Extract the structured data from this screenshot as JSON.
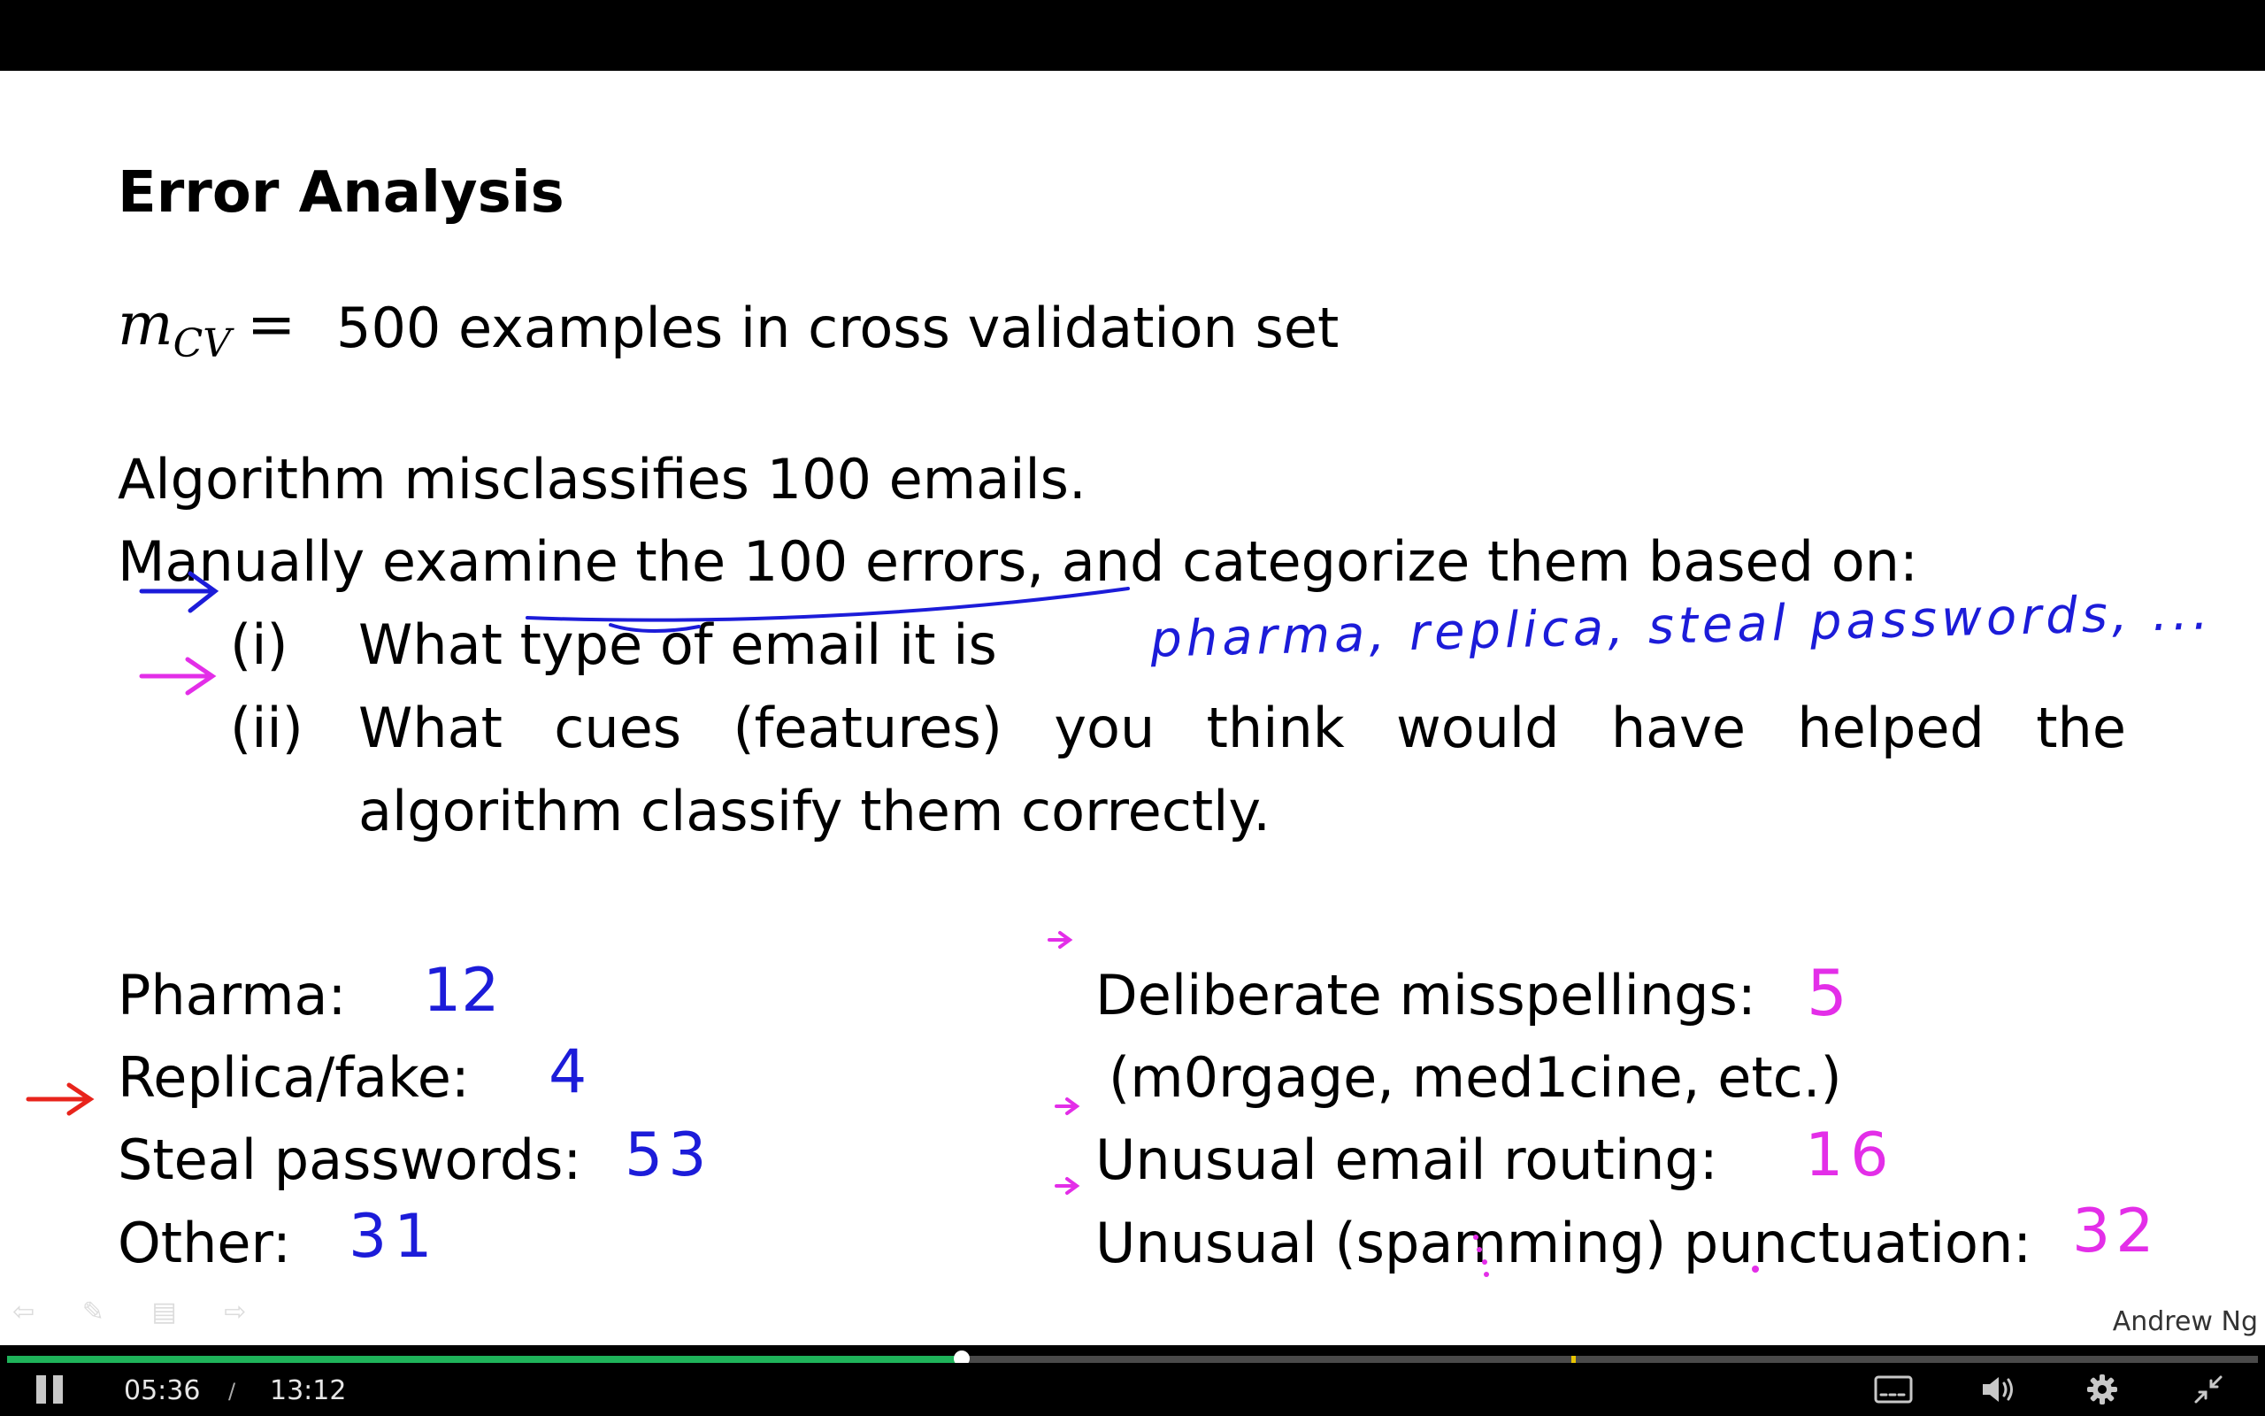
{
  "slide": {
    "title": "Error Analysis",
    "math_var": "m",
    "math_sub": "CV",
    "math_eq": "=",
    "line1": "500 examples in cross validation set",
    "line2": "Algorithm misclassifies 100 emails.",
    "line3": "Manually examine the 100 errors, and categorize them based on:",
    "item1_marker": "(i)",
    "item1_text": "What type of email it is",
    "item2_marker": "(ii)",
    "item2_line1": "What cues (features) you think would have helped the",
    "item2_line2": "algorithm classify them correctly.",
    "handwritten_types": "pharma, replica, steal passwords, ...",
    "categories": [
      {
        "label": "Pharma:",
        "count": "12"
      },
      {
        "label": "Replica/fake:",
        "count": "4"
      },
      {
        "label": "Steal passwords:",
        "count": "53"
      },
      {
        "label": "Other:",
        "count": "31"
      }
    ],
    "features": [
      {
        "label": "Deliberate misspellings:",
        "count": "5"
      },
      {
        "label": "(m0rgage, med1cine, etc.)",
        "count": ""
      },
      {
        "label": "Unusual email routing:",
        "count": "16"
      },
      {
        "label": "Unusual (spamming) punctuation:",
        "count": "32"
      }
    ],
    "author": "Andrew Ng",
    "ink_colors": {
      "blue": "#1c1cd9",
      "magenta": "#e32ee8",
      "red": "#e8241c"
    }
  },
  "player": {
    "current_time": "05:36",
    "separator": "/",
    "duration": "13:12",
    "progress_fraction": 0.4242,
    "marker_fraction": 0.695,
    "played_color": "#1fb35a",
    "buttons": {
      "pause": "pause-icon",
      "captions": "captions-icon",
      "volume": "volume-icon",
      "settings": "gear-icon",
      "exit_fullscreen": "exit-fullscreen-icon"
    }
  }
}
